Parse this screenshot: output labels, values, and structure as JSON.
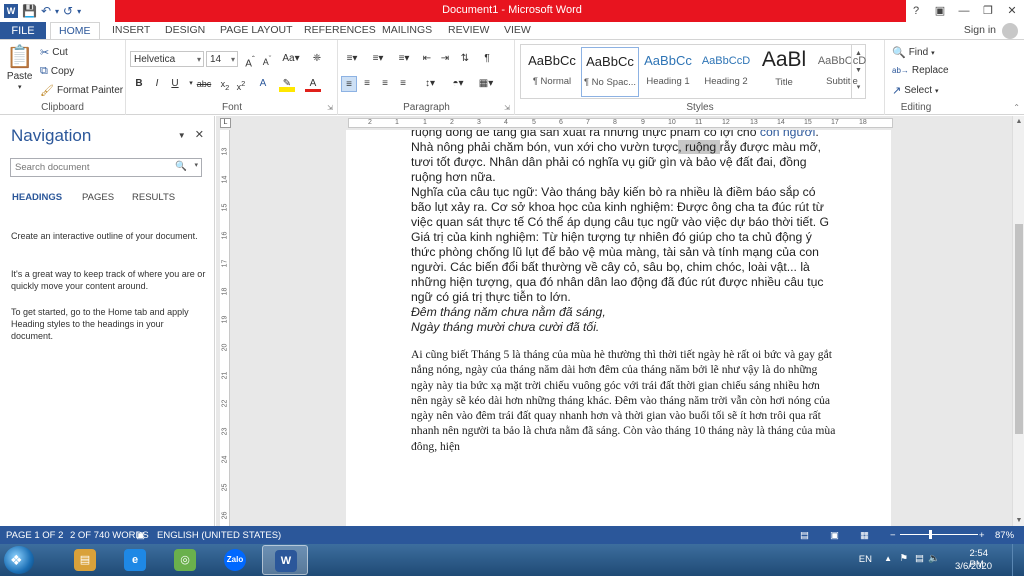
{
  "window": {
    "title": "Document1 - Microsoft Word",
    "help": "?",
    "controls": [
      "❐",
      "—",
      "❐",
      "✕"
    ],
    "signin": "Sign in"
  },
  "tabs": [
    "FILE",
    "HOME",
    "INSERT",
    "DESIGN",
    "PAGE LAYOUT",
    "REFERENCES",
    "MAILINGS",
    "REVIEW",
    "VIEW"
  ],
  "ribbon": {
    "clipboard": {
      "paste": "Paste",
      "cut": "Cut",
      "copy": "Copy",
      "format_painter": "Format Painter",
      "group": "Clipboard"
    },
    "font": {
      "name": "Helvetica",
      "size": "14",
      "group": "Font"
    },
    "paragraph": {
      "group": "Paragraph"
    },
    "styles": {
      "group": "Styles",
      "items": [
        {
          "sample": "AaBbCϲ",
          "name": "¶ Normal"
        },
        {
          "sample": "AaBbCϲ",
          "name": "¶ No Spac..."
        },
        {
          "sample": "AaBbCϲ",
          "name": "Heading 1"
        },
        {
          "sample": "AaBbCcD",
          "name": "Heading 2"
        },
        {
          "sample": "AaBl",
          "name": "Title"
        },
        {
          "sample": "AaBbCcD",
          "name": "Subtitle"
        }
      ]
    },
    "editing": {
      "find": "Find",
      "replace": "Replace",
      "select": "Select",
      "group": "Editing"
    }
  },
  "nav": {
    "title": "Navigation",
    "search_placeholder": "Search document",
    "tabs": [
      "HEADINGS",
      "PAGES",
      "RESULTS"
    ],
    "help1": "Create an interactive outline of your document.",
    "help2": "It's a great way to keep track of where you are or quickly move your content around.",
    "help3": "To get started, go to the Home tab and apply Heading styles to the headings in your document."
  },
  "ruler": {
    "h_labels": [
      "2",
      "1",
      "1",
      "2",
      "3",
      "4",
      "5",
      "6",
      "7",
      "8",
      "9",
      "10",
      "11",
      "12",
      "13",
      "14",
      "15",
      "17",
      "18"
    ],
    "v_labels": [
      "13",
      "14",
      "15",
      "16",
      "17",
      "18",
      "19",
      "20",
      "21",
      "22",
      "23",
      "24",
      "25",
      "26"
    ]
  },
  "document": {
    "para1_start": "ruộng đồng để tăng giá sản xuất ra những thực phẩm có lợi cho ",
    "para1_link": "con người",
    "para1_mid": ". Nhà nông phải chăm bón, vun xới cho vườn tược",
    "para1_hl": ", ruộng ",
    "para1_end": "rẫy được màu mỡ, tươi tốt được. Nhân dân phải có nghĩa vụ giữ gìn và bảo vệ đất đai, đồng ruộng hơn nữa.",
    "para2": "Nghĩa của câu tục ngữ: Vào tháng bảy kiến bò ra nhiều là điềm báo sắp có bão lụt xảy ra. Cơ sở khoa học của kinh nghiệm: Được ông cha ta đúc rút từ việc quan sát thực tế Có thể áp dụng câu tục ngữ vào việc dự báo thời tiết. G Giá trị của kinh nghiệm: Từ hiện tượng tự nhiên đó giúp cho ta chủ động ý thức phòng chống lũ lụt để bảo vệ mùa màng, tài sản và tính mạng của con người. Các biến đổi bất thường về cây cỏ, sâu bọ, chim chóc, loài vật... là những hiện tượng, qua đó nhân dân lao động đã đúc rút được nhiều câu tục ngữ có giá trị thực tiễn to lớn.",
    "verse1": "Đêm tháng năm chưa nằm đã sáng,",
    "verse2": "Ngày tháng mười chưa cười đã tối.",
    "para3": "Ai cũng biết  Tháng 5 là tháng của mùa hè thường thì thời tiết ngày hè rất oi bức và gay gắt nắng nóng, ngày của tháng năm dài hơn đêm của tháng năm bởi lẽ như vậy là do những ngày này tia bức xạ mặt trời chiếu vuông góc với trái đất thời gian chiếu sáng nhiều hơn nên ngày sẽ kéo dài hơn những tháng khác. Đêm vào tháng năm trời vẫn còn hơi nóng của ngày nên vào đêm trái đất quay nhanh hơn và thời gian vào buổi tối sẽ ít hơn trôi qua rất nhanh nên người ta bảo là chưa nằm đã sáng.  Còn vào tháng 10 tháng này là tháng của mùa đông, hiện"
  },
  "status": {
    "page": "PAGE 1 OF 2",
    "words": "2 OF 740 WORDS",
    "lang": "ENGLISH (UNITED STATES)",
    "zoom": "87%",
    "minus": "−",
    "plus": "+"
  },
  "taskbar": {
    "apps": [
      {
        "name": "explorer",
        "label": "▤",
        "color": "#d9a13a"
      },
      {
        "name": "ie",
        "label": "e",
        "color": "#1e88e5"
      },
      {
        "name": "coccoc",
        "label": "◎",
        "color": "#6ab04c"
      },
      {
        "name": "zalo",
        "label": "Zalo",
        "color": "#0068ff"
      },
      {
        "name": "word",
        "label": "W",
        "color": "#2b579a"
      }
    ],
    "lang": "EN",
    "time": "2:54 PM",
    "date": "3/6/2020"
  }
}
